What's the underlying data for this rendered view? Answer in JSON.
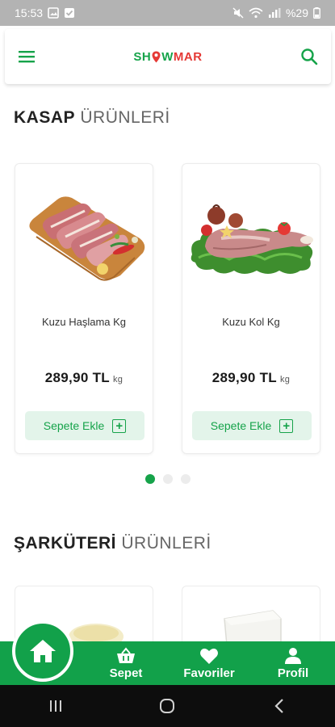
{
  "status_bar": {
    "time": "15:53",
    "battery": "%29"
  },
  "header": {
    "logo_part1": "SH",
    "logo_part2": "W",
    "logo_part3": "MAR"
  },
  "sections": [
    {
      "strong": "KASAP",
      "light": "ÜRÜNLERİ"
    },
    {
      "strong": "ŞARKÜTERİ",
      "light": "ÜRÜNLERİ"
    }
  ],
  "products": [
    {
      "name": "Kuzu Haşlama Kg",
      "price": "289,90 TL",
      "unit": "kg",
      "button": "Sepete Ekle"
    },
    {
      "name": "Kuzu Kol Kg",
      "price": "289,90 TL",
      "unit": "kg",
      "button": "Sepete Ekle"
    }
  ],
  "pagination": {
    "count": 3,
    "active_index": 0
  },
  "bottom_nav": {
    "items": [
      {
        "label": "Sepet",
        "icon": "basket-icon"
      },
      {
        "label": "Favoriler",
        "icon": "heart-icon"
      },
      {
        "label": "Profil",
        "icon": "user-icon"
      }
    ],
    "home_icon": "home-icon"
  },
  "colors": {
    "brand_green": "#12a14a",
    "accent_red": "#e53935",
    "button_bg": "#e3f4ea"
  }
}
